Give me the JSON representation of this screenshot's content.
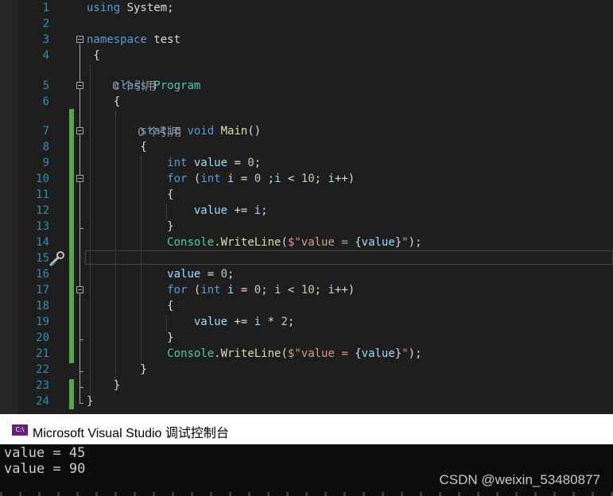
{
  "editor": {
    "lines": [
      {
        "n": "1",
        "tokens": [
          [
            "kw",
            "using "
          ],
          [
            "cm",
            "System;"
          ]
        ]
      },
      {
        "n": "2",
        "tokens": []
      },
      {
        "n": "3",
        "tokens": [
          [
            "kw",
            "namespace "
          ],
          [
            "cm",
            "test"
          ]
        ]
      },
      {
        "n": "4",
        "tokens": [
          [
            "cm",
            " {"
          ]
        ]
      },
      {
        "n": "5",
        "tokens": [
          [
            "cm",
            "    "
          ],
          [
            "kw",
            "class "
          ],
          [
            "ty",
            "Program"
          ]
        ]
      },
      {
        "n": "6",
        "tokens": [
          [
            "cm",
            "    {"
          ]
        ]
      },
      {
        "n": "7",
        "tokens": [
          [
            "cm",
            "        "
          ],
          [
            "kw",
            "static void "
          ],
          [
            "mt",
            "Main"
          ],
          [
            "cm",
            "()"
          ]
        ]
      },
      {
        "n": "8",
        "tokens": [
          [
            "cm",
            "        {"
          ]
        ]
      },
      {
        "n": "9",
        "tokens": [
          [
            "cm",
            "            "
          ],
          [
            "kw",
            "int "
          ],
          [
            "vr",
            "value"
          ],
          [
            "cm",
            " = "
          ],
          [
            "nm",
            "0"
          ],
          [
            "cm",
            ";"
          ]
        ]
      },
      {
        "n": "10",
        "tokens": [
          [
            "cm",
            "            "
          ],
          [
            "kw",
            "for "
          ],
          [
            "cm",
            "("
          ],
          [
            "kw",
            "int "
          ],
          [
            "vr",
            "i"
          ],
          [
            "cm",
            " = "
          ],
          [
            "nm",
            "0"
          ],
          [
            "cm",
            " ;"
          ],
          [
            "vr",
            "i"
          ],
          [
            "cm",
            " < "
          ],
          [
            "nm",
            "10"
          ],
          [
            "cm",
            "; "
          ],
          [
            "vr",
            "i"
          ],
          [
            "cm",
            "++)"
          ]
        ]
      },
      {
        "n": "11",
        "tokens": [
          [
            "cm",
            "            {"
          ]
        ]
      },
      {
        "n": "12",
        "tokens": [
          [
            "cm",
            "                "
          ],
          [
            "vr",
            "value"
          ],
          [
            "cm",
            " += "
          ],
          [
            "vr",
            "i"
          ],
          [
            "cm",
            ";"
          ]
        ]
      },
      {
        "n": "13",
        "tokens": [
          [
            "cm",
            "            }"
          ]
        ]
      },
      {
        "n": "14",
        "tokens": [
          [
            "cm",
            "            "
          ],
          [
            "ty",
            "Console"
          ],
          [
            "cm",
            "."
          ],
          [
            "mt",
            "WriteLine"
          ],
          [
            "cm",
            "("
          ],
          [
            "st",
            "$\"value = "
          ],
          [
            "cm",
            "{"
          ],
          [
            "vr",
            "value"
          ],
          [
            "cm",
            "}"
          ],
          [
            "st",
            "\""
          ],
          [
            "cm",
            ");"
          ]
        ]
      },
      {
        "n": "15",
        "tokens": []
      },
      {
        "n": "16",
        "tokens": [
          [
            "cm",
            "            "
          ],
          [
            "vr",
            "value"
          ],
          [
            "cm",
            " = "
          ],
          [
            "nm",
            "0"
          ],
          [
            "cm",
            ";"
          ]
        ]
      },
      {
        "n": "17",
        "tokens": [
          [
            "cm",
            "            "
          ],
          [
            "kw",
            "for "
          ],
          [
            "cm",
            "("
          ],
          [
            "kw",
            "int "
          ],
          [
            "vr",
            "i"
          ],
          [
            "cm",
            " = "
          ],
          [
            "nm",
            "0"
          ],
          [
            "cm",
            "; "
          ],
          [
            "vr",
            "i"
          ],
          [
            "cm",
            " < "
          ],
          [
            "nm",
            "10"
          ],
          [
            "cm",
            "; "
          ],
          [
            "vr",
            "i"
          ],
          [
            "cm",
            "++)"
          ]
        ]
      },
      {
        "n": "18",
        "tokens": [
          [
            "cm",
            "            {"
          ]
        ]
      },
      {
        "n": "19",
        "tokens": [
          [
            "cm",
            "                "
          ],
          [
            "vr",
            "value"
          ],
          [
            "cm",
            " += "
          ],
          [
            "vr",
            "i"
          ],
          [
            "cm",
            " * "
          ],
          [
            "nm",
            "2"
          ],
          [
            "cm",
            ";"
          ]
        ]
      },
      {
        "n": "20",
        "tokens": [
          [
            "cm",
            "            }"
          ]
        ]
      },
      {
        "n": "21",
        "tokens": [
          [
            "cm",
            "            "
          ],
          [
            "ty",
            "Console"
          ],
          [
            "cm",
            "."
          ],
          [
            "mt",
            "WriteLine"
          ],
          [
            "cm",
            "("
          ],
          [
            "st",
            "$\"value = "
          ],
          [
            "cm",
            "{"
          ],
          [
            "vr",
            "value"
          ],
          [
            "cm",
            "}"
          ],
          [
            "st",
            "\""
          ],
          [
            "cm",
            ");"
          ]
        ]
      },
      {
        "n": "22",
        "tokens": [
          [
            "cm",
            "        }"
          ]
        ]
      },
      {
        "n": "23",
        "tokens": [
          [
            "cm",
            "    }"
          ]
        ]
      },
      {
        "n": "24",
        "tokens": [
          [
            "cm",
            "}"
          ]
        ]
      }
    ],
    "codelens": {
      "class_refs": "0 个引用",
      "main_refs": "0 个引用"
    },
    "lightbulb_icon": "quick-actions-icon",
    "colors": {
      "keyword": "#569cd6",
      "type": "#4ec9b0",
      "method": "#dcdcaa",
      "string": "#d69d85",
      "number": "#b5cea8",
      "variable": "#9cdcfe",
      "line_number": "#2b91af",
      "change_bar": "#57a64a"
    }
  },
  "console": {
    "app_icon_text": "C:\\",
    "title": "Microsoft Visual Studio 调试控制台",
    "output": [
      "value = 45",
      "value = 90"
    ],
    "watermark": "CSDN @weixin_53480877"
  }
}
